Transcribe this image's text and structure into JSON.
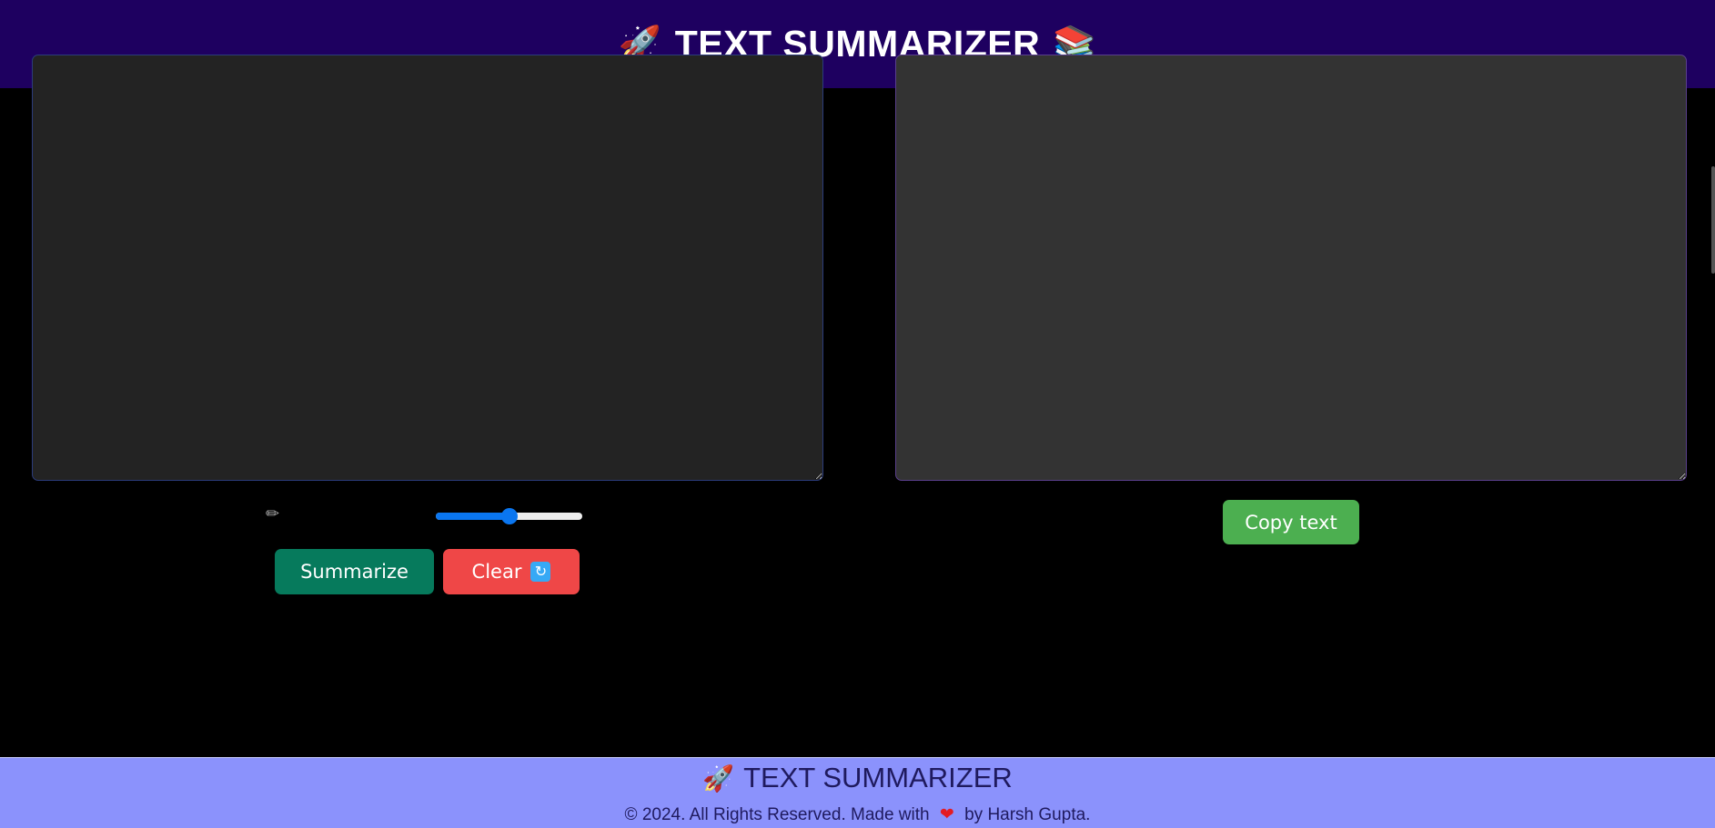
{
  "header": {
    "left_emoji": "🚀",
    "title": "TEXT SUMMARIZER",
    "right_emoji": "📚"
  },
  "input": {
    "value": ""
  },
  "controls": {
    "ruler_icon": "✏",
    "slider_value_percent": 50,
    "summarize_label": "Summarize",
    "clear_label": "Clear",
    "clear_icon": "🔄"
  },
  "output": {
    "value": "",
    "copy_label": "Copy text"
  },
  "footer": {
    "emoji": "🚀",
    "title": "TEXT SUMMARIZER",
    "copy_prefix": "© 2024. All Rights Reserved. Made with",
    "heart": "❤",
    "copy_suffix": "by Harsh Gupta."
  },
  "colors": {
    "header_bg": "#1e0060",
    "footer_bg": "#8b92fc",
    "summarize_bg": "#067a5c",
    "clear_bg": "#ef4747",
    "copy_bg": "#4caf50",
    "slider_accent": "#0a76f0"
  }
}
